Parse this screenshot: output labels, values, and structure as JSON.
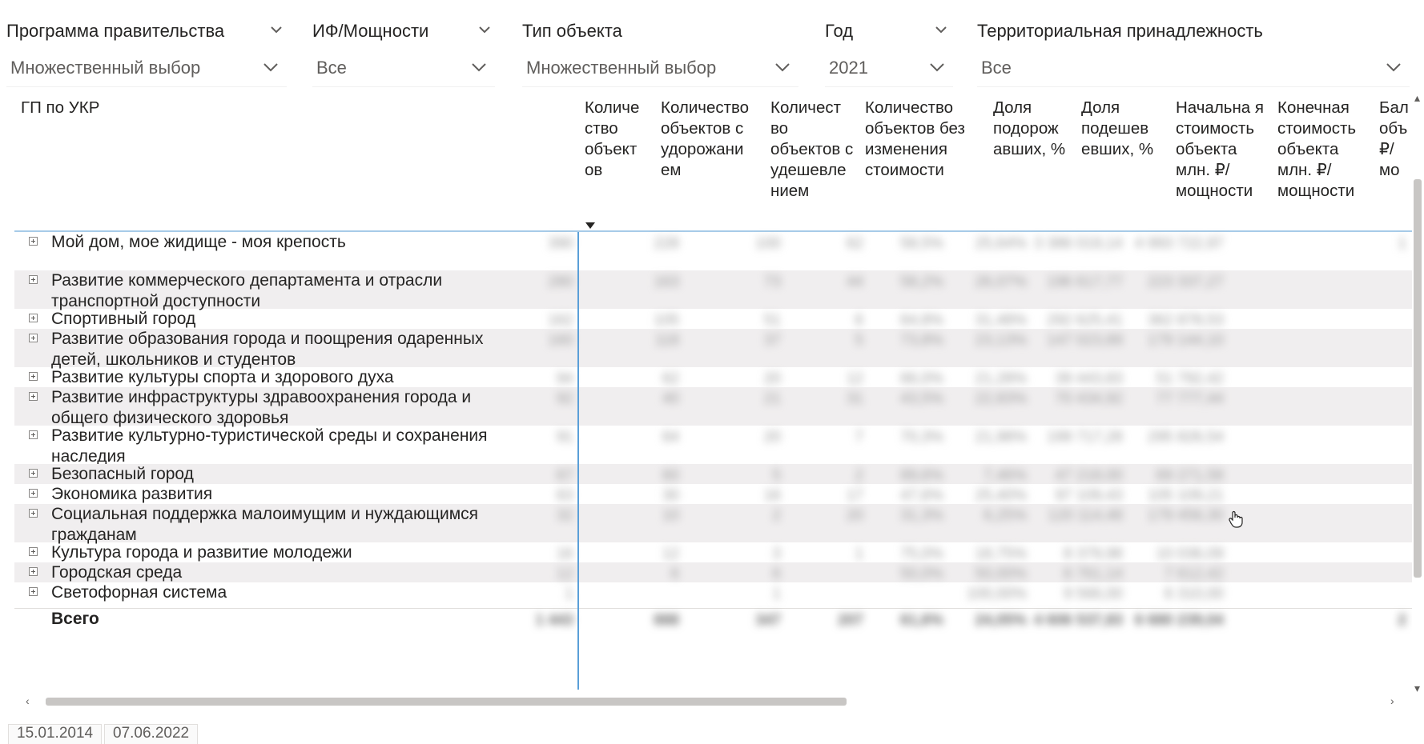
{
  "slicers": [
    {
      "title": "Программа правительства",
      "value": "Множественный выбор"
    },
    {
      "title": "ИФ/Мощности",
      "value": "Все"
    },
    {
      "title": "Тип объекта",
      "value": "Множественный выбор"
    },
    {
      "title": "Год",
      "value": "2021"
    },
    {
      "title": "Территориальная принадлежность",
      "value": "Все"
    }
  ],
  "matrix": {
    "row_header": "ГП по УКР",
    "columns": [
      "Количе ство объект ов",
      "Количество объектов с удорожани ем",
      "Количест во объектов с удешевле нием",
      "Количество объектов без изменения стоимости",
      "Доля подорож авших, %",
      "Доля подешев евших, %",
      "Начальна я стоимость объекта млн. ₽/ мощности",
      "Конечная стоимость объекта млн. ₽/ мощности",
      "Бал объ ₽/мо"
    ],
    "rows": [
      {
        "label": "Мой дом, мое жидище - моя крепость",
        "values": [
          "390",
          "228",
          "100",
          "62",
          "58,5%",
          "25,64%",
          "3 386 019,14",
          "4 993 722,97",
          "1"
        ]
      },
      {
        "label": "Развитие коммерческого департамента и отрасли транспортной доступности",
        "values": [
          "280",
          "163",
          "73",
          "44",
          "58,2%",
          "26,07%",
          "196 617,77",
          "223 337,27",
          ""
        ]
      },
      {
        "label": "Спортивный город",
        "values": [
          "162",
          "105",
          "51",
          "6",
          "64,8%",
          "31,48%",
          "292 625,41",
          "362 878,53",
          ""
        ]
      },
      {
        "label": "Развитие образования города и поощрения одаренных детей, школьников и студентов",
        "values": [
          "160",
          "118",
          "37",
          "5",
          "73,8%",
          "23,13%",
          "147 023,89",
          "179 144,10",
          ""
        ]
      },
      {
        "label": "Развитие культуры спорта и здорового духа",
        "values": [
          "94",
          "62",
          "20",
          "12",
          "66,0%",
          "21,28%",
          "39 443,83",
          "51 792,42",
          ""
        ]
      },
      {
        "label": "Развитие инфраструктуры здравоохранения города и общего физического здоровья",
        "values": [
          "92",
          "40",
          "21",
          "31",
          "43,5%",
          "22,83%",
          "70 434,92",
          "77 777,44",
          ""
        ]
      },
      {
        "label": "Развитие культурно-туристической среды и сохранения наследия",
        "values": [
          "91",
          "64",
          "20",
          "7",
          "70,3%",
          "21,98%",
          "199 717,28",
          "295 826,54",
          ""
        ]
      },
      {
        "label": "Безопасный город",
        "values": [
          "67",
          "60",
          "5",
          "2",
          "89,6%",
          "7,46%",
          "47 218,00",
          "69 271,58",
          ""
        ]
      },
      {
        "label": "Экономика развития",
        "values": [
          "63",
          "30",
          "16",
          "17",
          "47,6%",
          "25,40%",
          "97 109,43",
          "105 109,21",
          ""
        ]
      },
      {
        "label": "Социальная поддержка малоимущим и нуждающимся гражданам",
        "values": [
          "32",
          "10",
          "2",
          "20",
          "31,3%",
          "6,25%",
          "120 114,48",
          "179 456,30",
          ""
        ]
      },
      {
        "label": "Культура города и развитие молодежи",
        "values": [
          "16",
          "12",
          "3",
          "1",
          "75,0%",
          "18,75%",
          "8 379,98",
          "10 036,09",
          ""
        ]
      },
      {
        "label": "Городская среда",
        "values": [
          "12",
          "6",
          "6",
          "",
          "50,0%",
          "50,00%",
          "6 761,14",
          "7 612,42",
          ""
        ]
      },
      {
        "label": "Светофорная система",
        "values": [
          "1",
          "",
          "1",
          "",
          "",
          "100,00%",
          "9 566,00",
          "6 310,00",
          ""
        ]
      }
    ],
    "total": {
      "label": "Всего",
      "values": [
        "1 443",
        "888",
        "347",
        "207",
        "61,6%",
        "24,05%",
        "4 606 537,83",
        "6 680 239,04",
        "2"
      ]
    }
  },
  "date_tabs": [
    "15.01.2014",
    "07.06.2022"
  ],
  "colors": {
    "divider": "#5a9fd8",
    "header_line": "#a7cbe8",
    "alt_row": "#f0eeef"
  }
}
